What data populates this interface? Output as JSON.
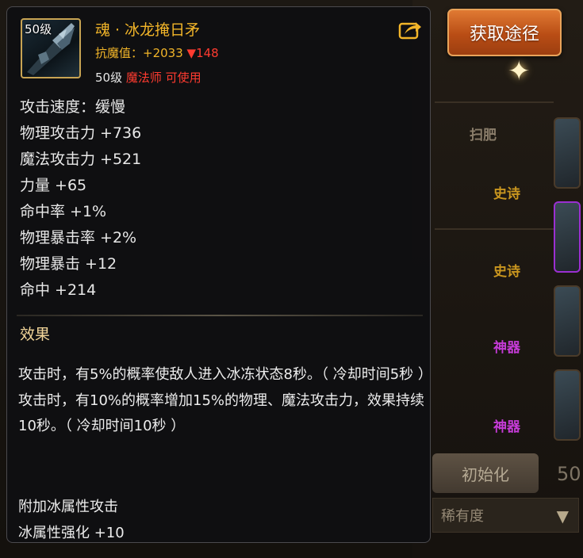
{
  "item": {
    "level_badge": "50级",
    "name": "魂 · 冰龙掩日矛",
    "resist_label": "抗魔值：",
    "resist_value": "+2033",
    "resist_change": "▼148",
    "req_level": "50级",
    "req_class": "魔法师 可使用",
    "stats": [
      "攻击速度：缓慢",
      "物理攻击力 +736",
      "魔法攻击力 +521",
      "力量 +65",
      "命中率 +1%",
      "物理暴击率 +2%",
      "物理暴击 +12",
      "命中 +214"
    ],
    "effects_title": "效果",
    "effects": [
      "攻击时，有5%的概率使敌人进入冰冻状态8秒。（ 冷却时间5秒 ）",
      "攻击时，有10%的概率增加15%的物理、魔法攻击力，效果持续10秒。（ 冷却时间10秒 ）"
    ],
    "extra": [
      "附加冰属性攻击",
      "冰属性强化 +10"
    ]
  },
  "actions": {
    "get_route_label": "获取途径"
  },
  "background": {
    "header_label": "扫肥",
    "grades": [
      "史诗",
      "史诗",
      "神器",
      "神器"
    ],
    "init_button": "初始化",
    "rarity_select": "稀有度",
    "partial_number": "50"
  },
  "colors": {
    "title_gold": "#f2b529",
    "decrease_red": "#ff3b30",
    "epic_gold": "#c9961f",
    "artifact_purple": "#c43bd6",
    "button_orange": "#c4581b"
  },
  "icons": {
    "item": "ice-dragon-spear-icon",
    "share": "share-arrow-icon",
    "dropdown": "triangle-down-icon",
    "sparkle": "sparkle-star-icon"
  }
}
